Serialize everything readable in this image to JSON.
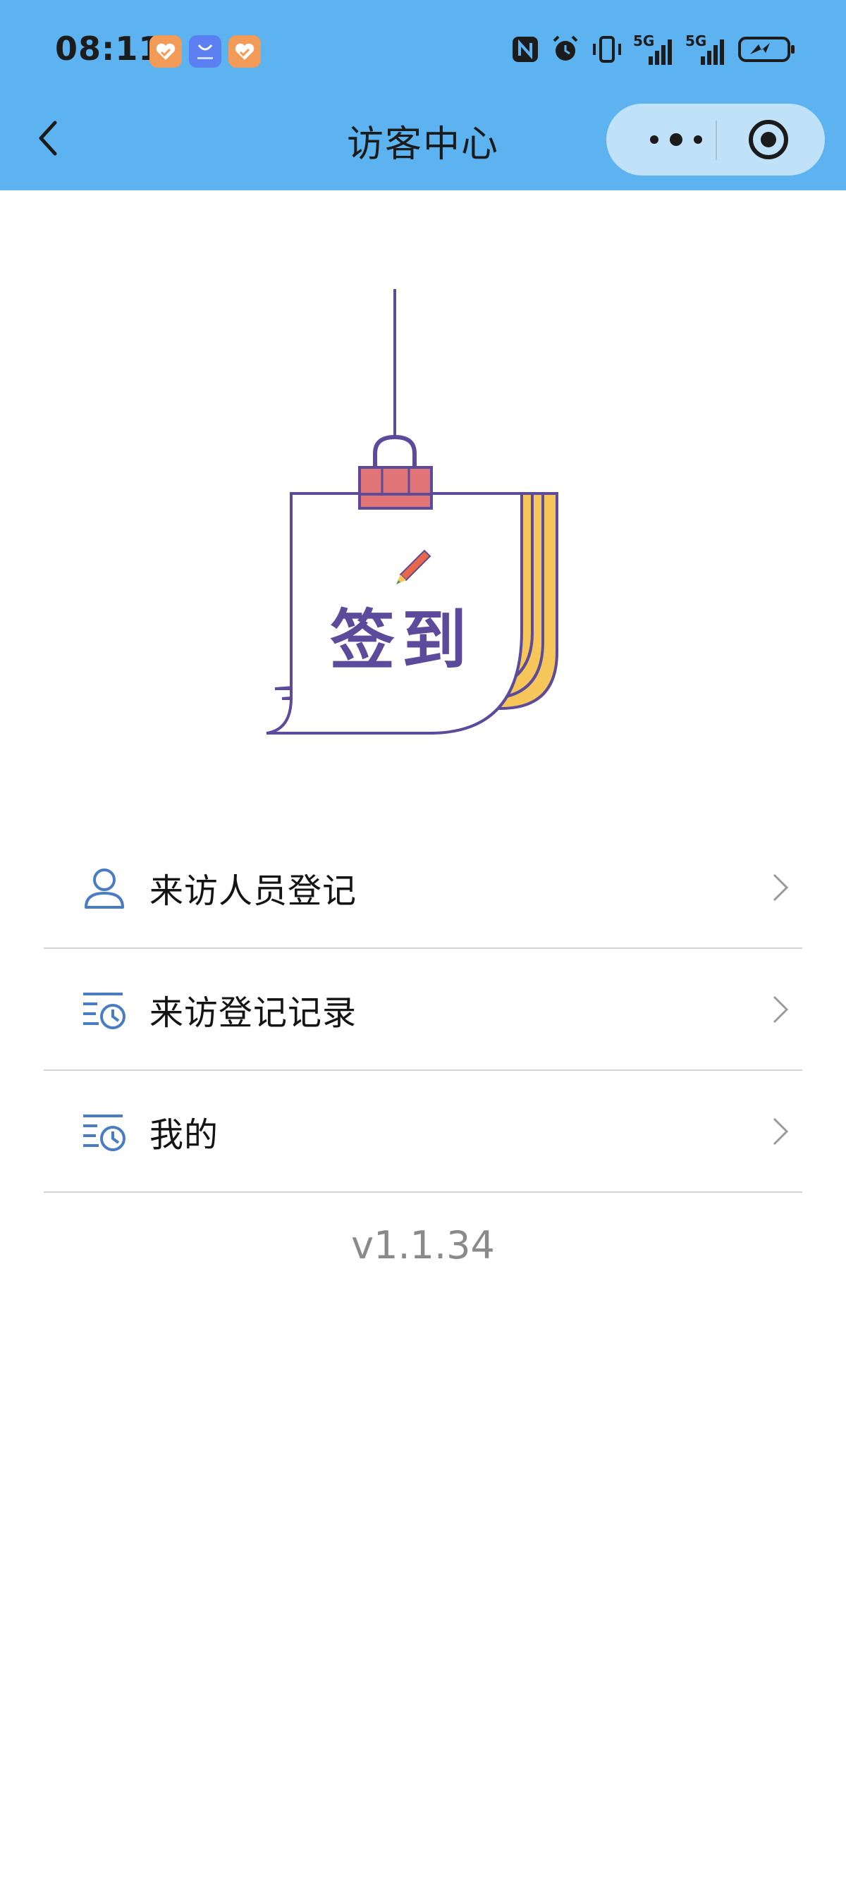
{
  "status_bar": {
    "time": "08:11",
    "app_icons": [
      "health-app-icon",
      "honor-store-icon",
      "health-app-icon"
    ],
    "indicators": [
      "nfc-icon",
      "alarm-icon",
      "vibrate-icon",
      "signal-5g-icon",
      "signal-5g-icon",
      "battery-charging-icon"
    ],
    "network_1": "5G",
    "network_2": "5G"
  },
  "nav": {
    "title": "访客中心",
    "back_icon": "chevron-left-icon",
    "more_icon": "more-dots-icon",
    "close_icon": "target-circle-icon"
  },
  "illustration": {
    "text": "签到",
    "icon": "pencil-icon"
  },
  "menu": {
    "items": [
      {
        "label": "来访人员登记",
        "icon": "person-icon"
      },
      {
        "label": "来访登记记录",
        "icon": "list-clock-icon"
      },
      {
        "label": "我的",
        "icon": "list-clock-icon"
      }
    ]
  },
  "version": "v1.1.34",
  "colors": {
    "header_bg": "#5cb3f0",
    "capsule_bg": "#bfe2f8",
    "icon_blue": "#4a7cc4",
    "purple": "#5b4b9a",
    "clip_red": "#e07476",
    "paper_yellow": "#f7c65b"
  }
}
